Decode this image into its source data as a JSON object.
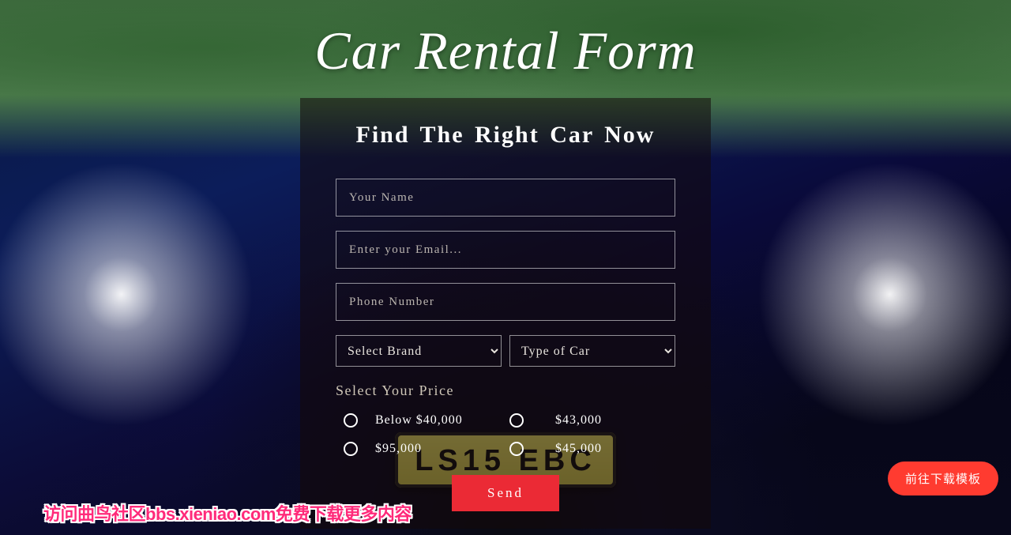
{
  "page": {
    "title": "Car Rental Form",
    "plate": "LS15 EBC"
  },
  "form": {
    "heading": "Find The Right Car Now",
    "name_placeholder": "Your Name",
    "email_placeholder": "Enter your Email...",
    "phone_placeholder": "Phone Number",
    "brand_selected": "Select Brand",
    "type_selected": "Type of Car",
    "price_label": "Select Your Price",
    "prices": {
      "p0": "Below $40,000",
      "p1": "$43,000",
      "p2": "$95,000",
      "p3": "$45,000"
    },
    "send_label": "Send"
  },
  "actions": {
    "download_label": "前往下载模板"
  },
  "footer": {
    "watermark": "访问曲鸟社区bbs.xieniao.com免费下载更多内容"
  }
}
